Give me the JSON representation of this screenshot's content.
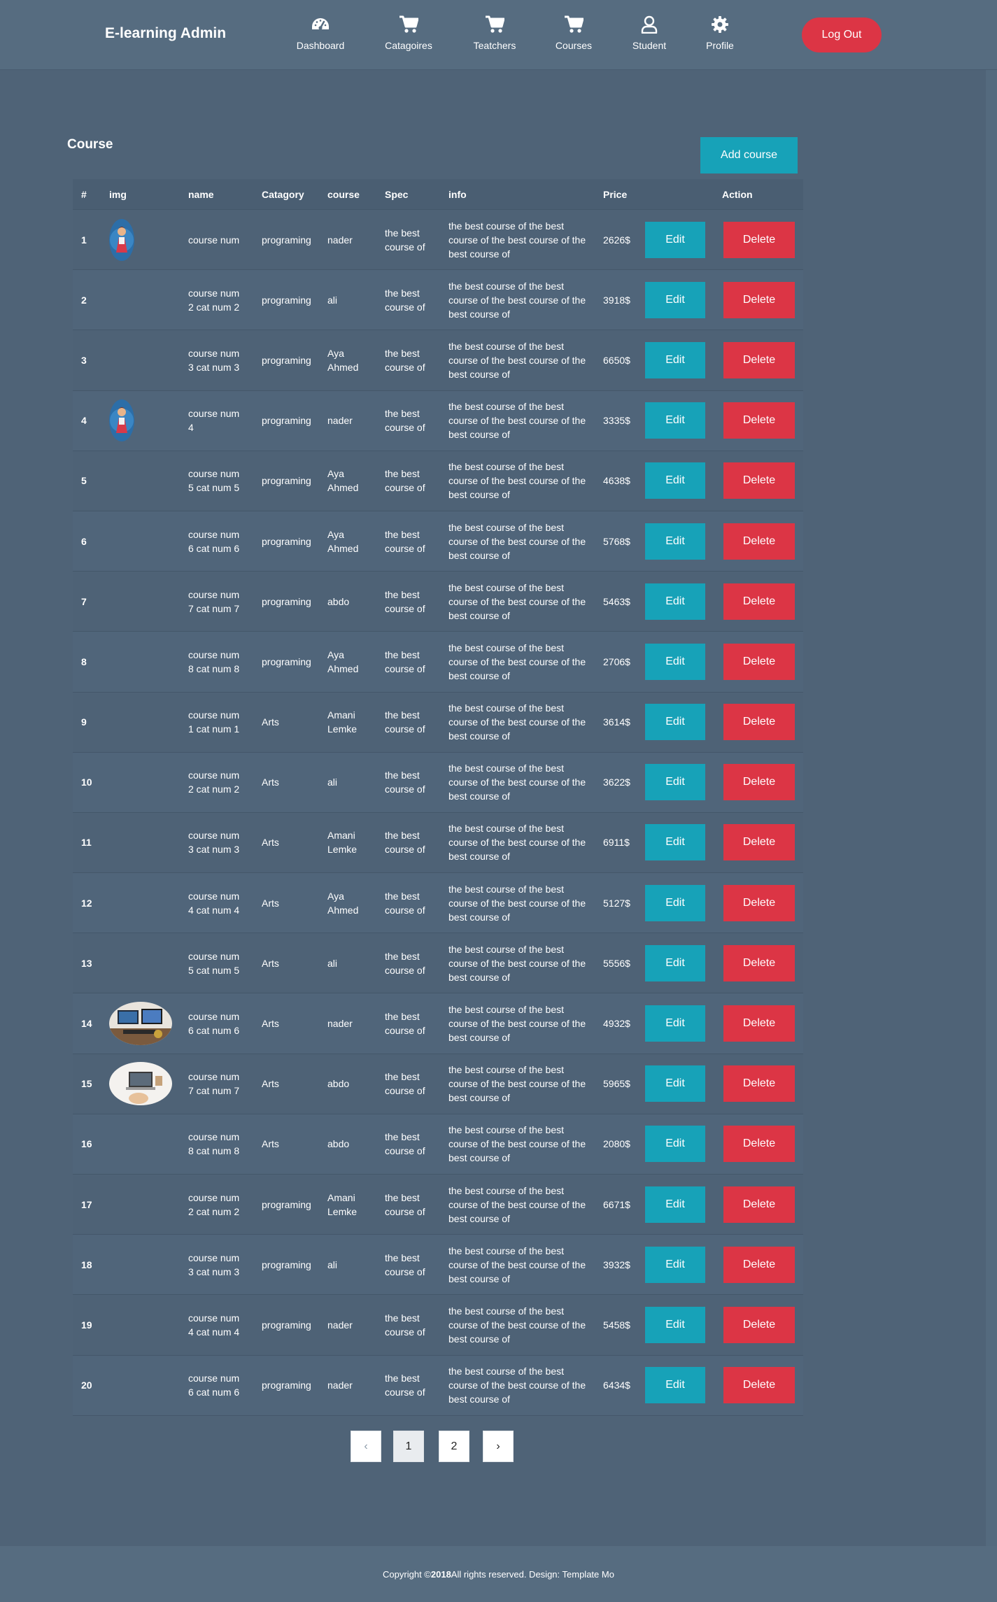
{
  "header": {
    "brand": "E-learning Admin",
    "nav": [
      {
        "label": "Dashboard",
        "icon": "dashboard-gauge-icon"
      },
      {
        "label": "Catagoires",
        "icon": "cart-icon"
      },
      {
        "label": "Teatchers",
        "icon": "cart-icon"
      },
      {
        "label": "Courses",
        "icon": "cart-icon"
      },
      {
        "label": "Student",
        "icon": "user-icon"
      },
      {
        "label": "Profile",
        "icon": "gear-icon"
      }
    ],
    "logout_label": "Log Out"
  },
  "main": {
    "title": "Course",
    "add_label": "Add course",
    "columns": [
      "#",
      "img",
      "name",
      "Catagory",
      "course",
      "Spec",
      "info",
      "Price",
      "Action"
    ],
    "edit_label": "Edit",
    "delete_label": "Delete",
    "rows": [
      {
        "num": "1",
        "img": "girl-portrait",
        "name": [
          "course num",
          ""
        ],
        "cat": "programing",
        "course": [
          "nader",
          ""
        ],
        "spec": [
          "the best",
          "course of"
        ],
        "info": [
          "the best course of the best",
          "course of the best course of the",
          "best course of"
        ],
        "price": "2626$"
      },
      {
        "num": "2",
        "img": "",
        "name": [
          "course num",
          "2 cat num 2"
        ],
        "cat": "programing",
        "course": [
          "ali",
          ""
        ],
        "spec": [
          "the best",
          "course of"
        ],
        "info": [
          "the best course of the best",
          "course of the best course of the",
          "best course of"
        ],
        "price": "3918$"
      },
      {
        "num": "3",
        "img": "",
        "name": [
          "course num",
          "3 cat num 3"
        ],
        "cat": "programing",
        "course": [
          "Aya",
          "Ahmed"
        ],
        "spec": [
          "the best",
          "course of"
        ],
        "info": [
          "the best course of the best",
          "course of the best course of the",
          "best course of"
        ],
        "price": "6650$"
      },
      {
        "num": "4",
        "img": "girl-portrait",
        "name": [
          "course num",
          "4"
        ],
        "cat": "programing",
        "course": [
          "nader",
          ""
        ],
        "spec": [
          "the best",
          "course of"
        ],
        "info": [
          "the best course of the best",
          "course of the best course of the",
          "best course of"
        ],
        "price": "3335$"
      },
      {
        "num": "5",
        "img": "",
        "name": [
          "course num",
          "5 cat num 5"
        ],
        "cat": "programing",
        "course": [
          "Aya",
          "Ahmed"
        ],
        "spec": [
          "the best",
          "course of"
        ],
        "info": [
          "the best course of the best",
          "course of the best course of the",
          "best course of"
        ],
        "price": "4638$"
      },
      {
        "num": "6",
        "img": "",
        "name": [
          "course num",
          "6 cat num 6"
        ],
        "cat": "programing",
        "course": [
          "Aya",
          "Ahmed"
        ],
        "spec": [
          "the best",
          "course of"
        ],
        "info": [
          "the best course of the best",
          "course of the best course of the",
          "best course of"
        ],
        "price": "5768$"
      },
      {
        "num": "7",
        "img": "",
        "name": [
          "course num",
          "7 cat num 7"
        ],
        "cat": "programing",
        "course": [
          "abdo",
          ""
        ],
        "spec": [
          "the best",
          "course of"
        ],
        "info": [
          "the best course of the best",
          "course of the best course of the",
          "best course of"
        ],
        "price": "5463$"
      },
      {
        "num": "8",
        "img": "",
        "name": [
          "course num",
          "8 cat num 8"
        ],
        "cat": "programing",
        "course": [
          "Aya",
          "Ahmed"
        ],
        "spec": [
          "the best",
          "course of"
        ],
        "info": [
          "the best course of the best",
          "course of the best course of the",
          "best course of"
        ],
        "price": "2706$"
      },
      {
        "num": "9",
        "img": "",
        "name": [
          "course num",
          "1 cat num 1"
        ],
        "cat": "Arts",
        "course": [
          "Amani",
          "Lemke"
        ],
        "spec": [
          "the best",
          "course of"
        ],
        "info": [
          "the best course of the best",
          "course of the best course of the",
          "best course of"
        ],
        "price": "3614$"
      },
      {
        "num": "10",
        "img": "",
        "name": [
          "course num",
          "2 cat num 2"
        ],
        "cat": "Arts",
        "course": [
          "ali",
          ""
        ],
        "spec": [
          "the best",
          "course of"
        ],
        "info": [
          "the best course of the best",
          "course of the best course of the",
          "best course of"
        ],
        "price": "3622$"
      },
      {
        "num": "11",
        "img": "",
        "name": [
          "course num",
          "3 cat num 3"
        ],
        "cat": "Arts",
        "course": [
          "Amani",
          "Lemke"
        ],
        "spec": [
          "the best",
          "course of"
        ],
        "info": [
          "the best course of the best",
          "course of the best course of the",
          "best course of"
        ],
        "price": "6911$"
      },
      {
        "num": "12",
        "img": "",
        "name": [
          "course num",
          "4 cat num 4"
        ],
        "cat": "Arts",
        "course": [
          "Aya",
          "Ahmed"
        ],
        "spec": [
          "the best",
          "course of"
        ],
        "info": [
          "the best course of the best",
          "course of the best course of the",
          "best course of"
        ],
        "price": "5127$"
      },
      {
        "num": "13",
        "img": "",
        "name": [
          "course num",
          "5 cat num 5"
        ],
        "cat": "Arts",
        "course": [
          "ali",
          ""
        ],
        "spec": [
          "the best",
          "course of"
        ],
        "info": [
          "the best course of the best",
          "course of the best course of the",
          "best course of"
        ],
        "price": "5556$"
      },
      {
        "num": "14",
        "img": "desk-screens",
        "name": [
          "course num",
          "6 cat num 6"
        ],
        "cat": "Arts",
        "course": [
          "nader",
          ""
        ],
        "spec": [
          "the best",
          "course of"
        ],
        "info": [
          "the best course of the best",
          "course of the best course of the",
          "best course of"
        ],
        "price": "4932$"
      },
      {
        "num": "15",
        "img": "laptop-desk",
        "name": [
          "course num",
          "7 cat num 7"
        ],
        "cat": "Arts",
        "course": [
          "abdo",
          ""
        ],
        "spec": [
          "the best",
          "course of"
        ],
        "info": [
          "the best course of the best",
          "course of the best course of the",
          "best course of"
        ],
        "price": "5965$"
      },
      {
        "num": "16",
        "img": "",
        "name": [
          "course num",
          "8 cat num 8"
        ],
        "cat": "Arts",
        "course": [
          "abdo",
          ""
        ],
        "spec": [
          "the best",
          "course of"
        ],
        "info": [
          "the best course of the best",
          "course of the best course of the",
          "best course of"
        ],
        "price": "2080$"
      },
      {
        "num": "17",
        "img": "",
        "name": [
          "course num",
          "2 cat num 2"
        ],
        "cat": "programing",
        "course": [
          "Amani",
          "Lemke"
        ],
        "spec": [
          "the best",
          "course of"
        ],
        "info": [
          "the best course of the best",
          "course of the best course of the",
          "best course of"
        ],
        "price": "6671$"
      },
      {
        "num": "18",
        "img": "",
        "name": [
          "course num",
          "3 cat num 3"
        ],
        "cat": "programing",
        "course": [
          "ali",
          ""
        ],
        "spec": [
          "the best",
          "course of"
        ],
        "info": [
          "the best course of the best",
          "course of the best course of the",
          "best course of"
        ],
        "price": "3932$"
      },
      {
        "num": "19",
        "img": "",
        "name": [
          "course num",
          "4 cat num 4"
        ],
        "cat": "programing",
        "course": [
          "nader",
          ""
        ],
        "spec": [
          "the best",
          "course of"
        ],
        "info": [
          "the best course of the best",
          "course of the best course of the",
          "best course of"
        ],
        "price": "5458$"
      },
      {
        "num": "20",
        "img": "",
        "name": [
          "course num",
          "6 cat num 6"
        ],
        "cat": "programing",
        "course": [
          "nader",
          ""
        ],
        "spec": [
          "the best",
          "course of"
        ],
        "info": [
          "the best course of the best",
          "course of the best course of the",
          "best course of"
        ],
        "price": "6434$"
      }
    ]
  },
  "pagination": {
    "prev": "‹",
    "pages": [
      "1",
      "2"
    ],
    "active": "1",
    "next": "›"
  },
  "footer": {
    "prefix": "Copyright © ",
    "year": "2018",
    "suffix": " All rights reserved. Design: Template Mo"
  },
  "colors": {
    "background": "#4f6377",
    "header": "#566c80",
    "accent": "#17a2b8",
    "danger": "#dc3545"
  }
}
